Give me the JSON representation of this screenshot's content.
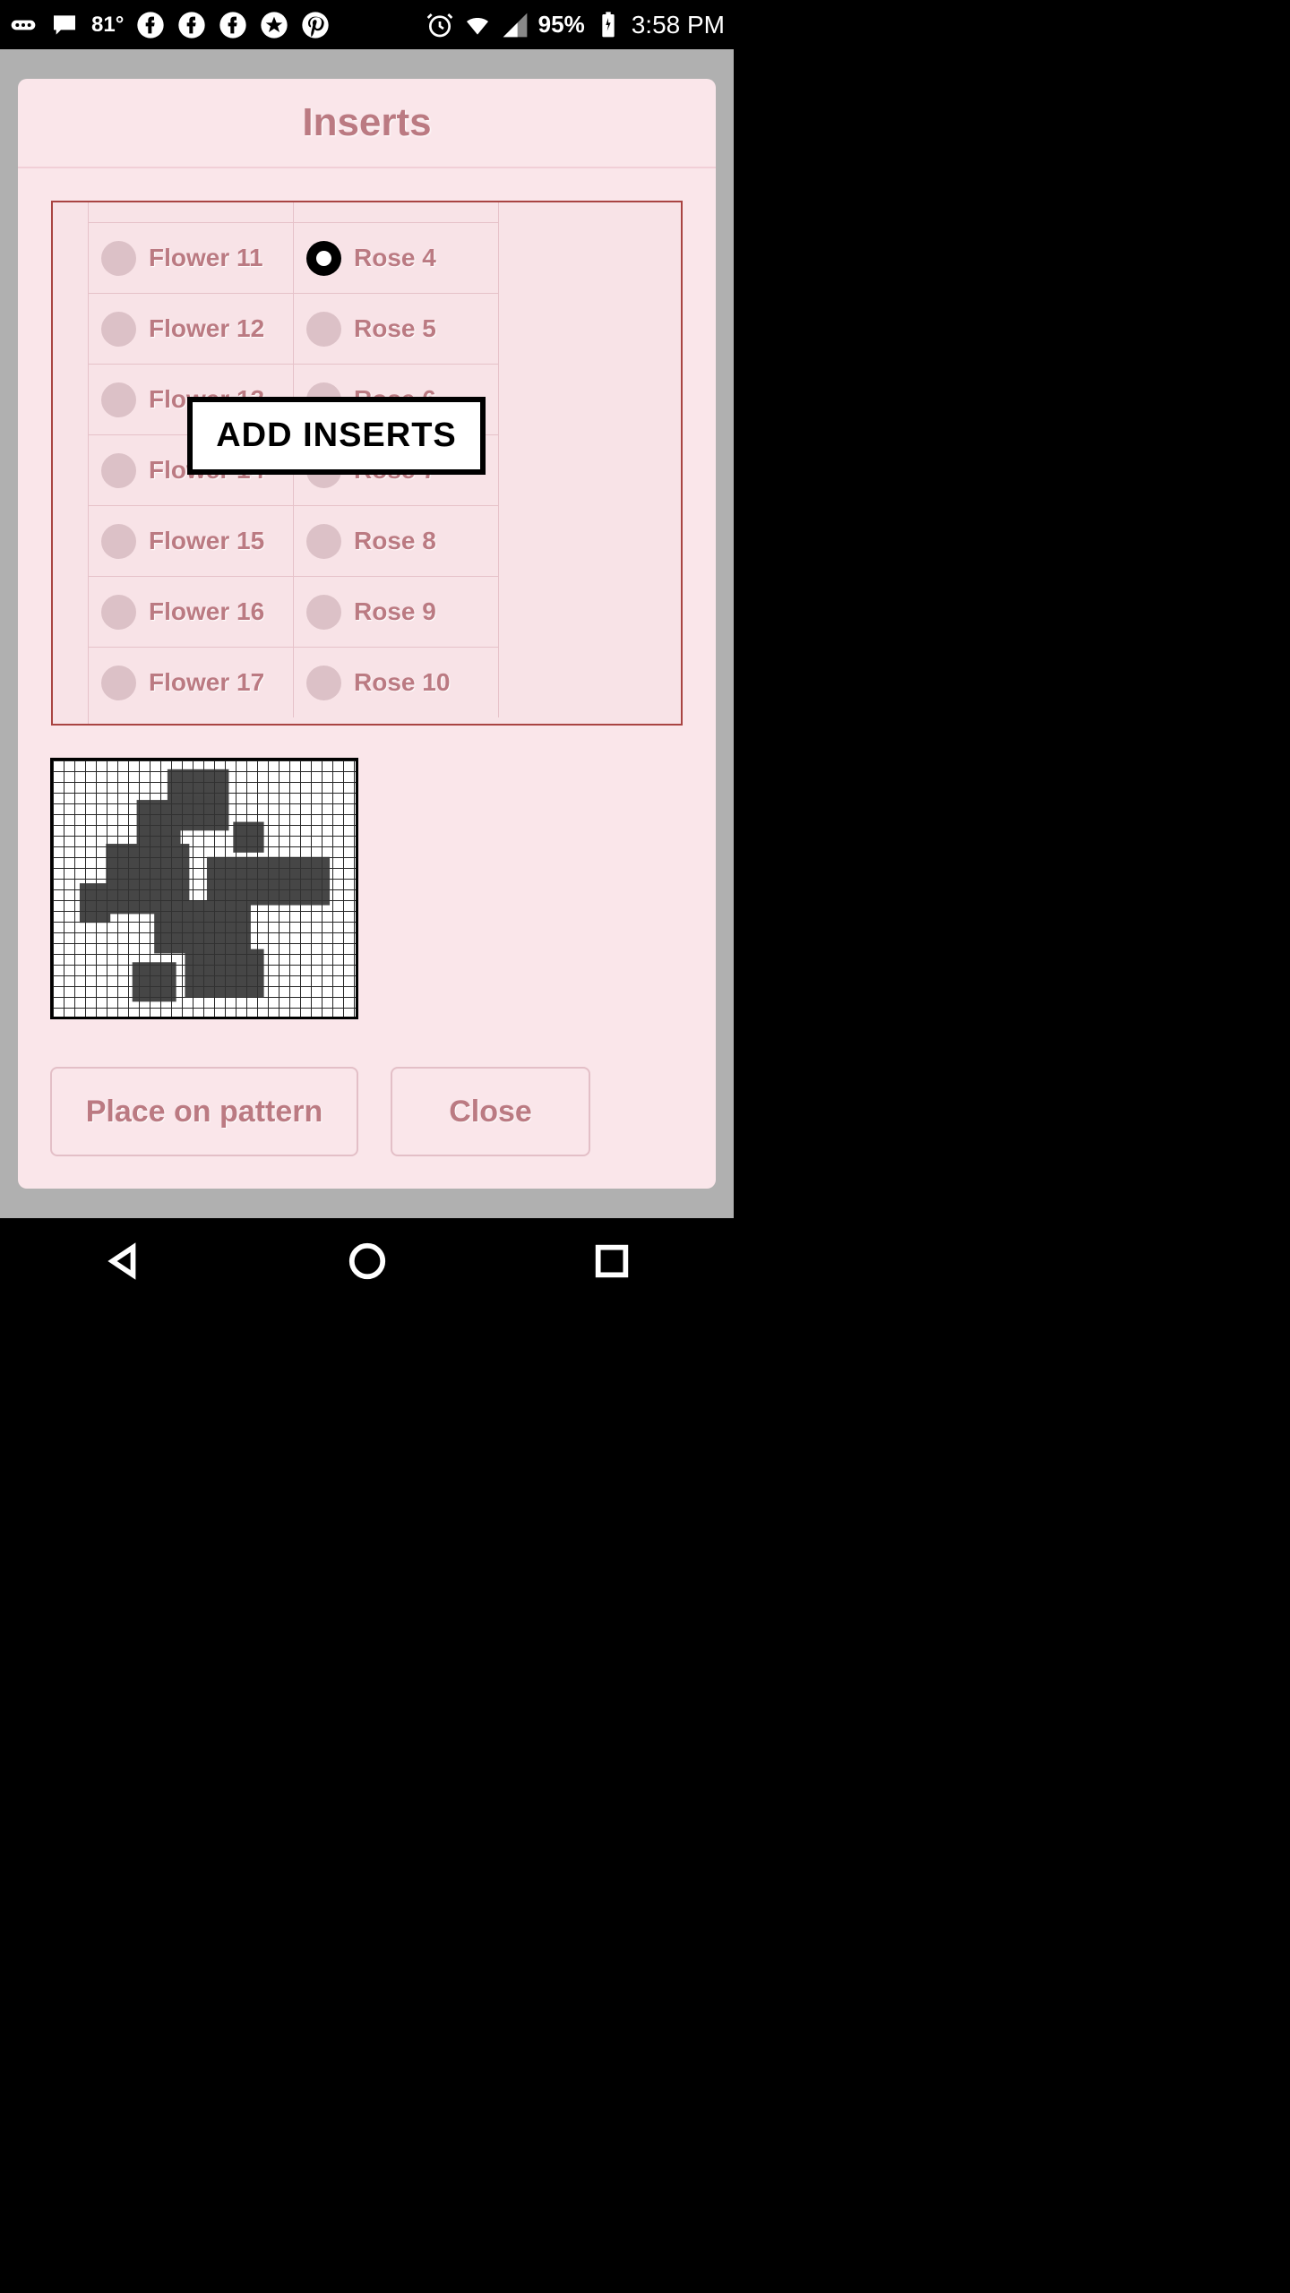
{
  "status": {
    "temp": "81°",
    "battery_pct": "95%",
    "time": "3:58 PM",
    "icons_left": [
      "more-icon",
      "messages-icon",
      "facebook-icon",
      "facebook-icon",
      "facebook-icon",
      "star-badge-icon",
      "pinterest-icon"
    ],
    "icons_right": [
      "alarm-icon",
      "wifi-icon",
      "cell-signal-icon",
      "battery-charging-icon"
    ]
  },
  "dialog": {
    "title": "Inserts",
    "overlay_label": "ADD INSERTS",
    "col1": {
      "items": [
        {
          "label": "Flower 11",
          "selected": false
        },
        {
          "label": "Flower 12",
          "selected": false
        },
        {
          "label": "Flower 13",
          "selected": false
        },
        {
          "label": "Flower 14",
          "selected": false
        },
        {
          "label": "Flower 15",
          "selected": false
        },
        {
          "label": "Flower 16",
          "selected": false
        },
        {
          "label": "Flower 17",
          "selected": false
        }
      ]
    },
    "col2": {
      "items": [
        {
          "label": "Rose 4",
          "selected": true
        },
        {
          "label": "Rose 5",
          "selected": false
        },
        {
          "label": "Rose 6",
          "selected": false
        },
        {
          "label": "Rose 7",
          "selected": false
        },
        {
          "label": "Rose 8",
          "selected": false
        },
        {
          "label": "Rose 9",
          "selected": false
        },
        {
          "label": "Rose 10",
          "selected": false
        }
      ]
    },
    "buttons": {
      "place": "Place on pattern",
      "close": "Close"
    }
  }
}
